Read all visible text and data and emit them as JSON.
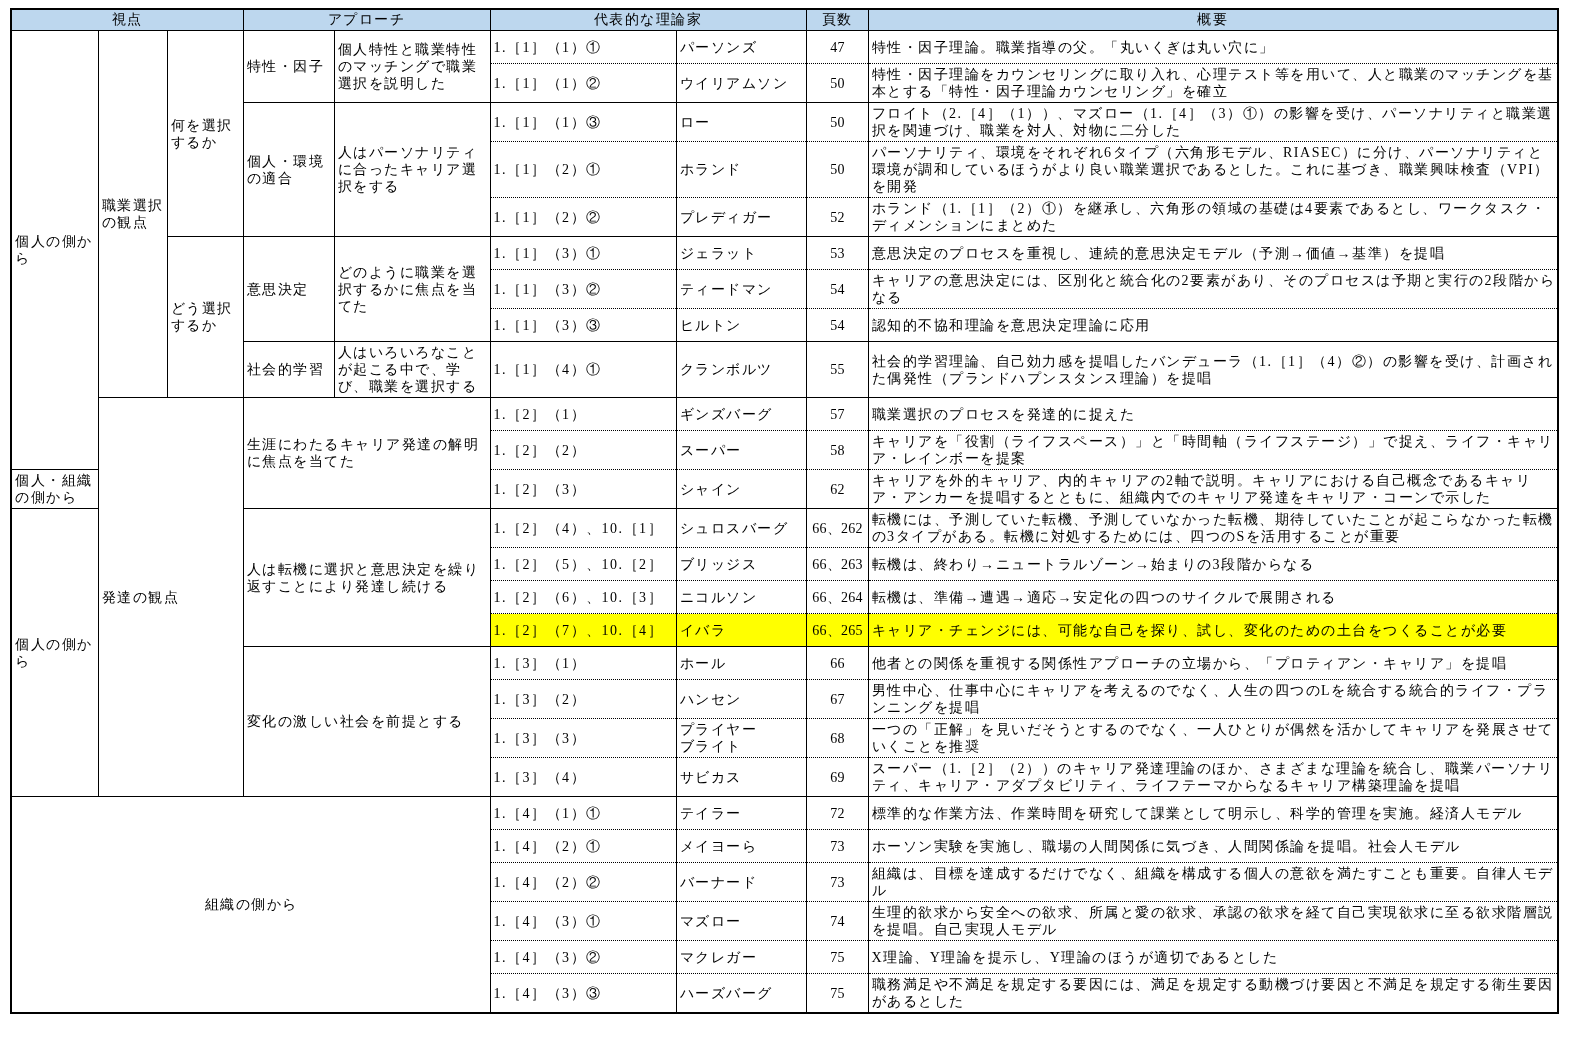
{
  "table": {
    "columns": [
      {
        "label": "視点"
      },
      {
        "label": "アプローチ"
      },
      {
        "label": "代表的な理論家"
      },
      {
        "label": "頁数"
      },
      {
        "label": "概要"
      }
    ],
    "rows": [
      {
        "side": "個人の側から",
        "viewpoint": {
          "text": "職業選択の観点",
          "kind": "single"
        },
        "focus": "何を選択するか",
        "approach": {
          "kind": "split",
          "name": "特性・因子",
          "description": "個人特性と職業特性のマッチングで職業選択を説明した"
        },
        "reference": "1.［1］（1）①",
        "theorists": [
          "パーソンズ"
        ],
        "pages": "47",
        "summary": "特性・因子理論。職業指導の父。「丸いくぎは丸い穴に」",
        "highlighted": false
      },
      {
        "reference": "1.［1］（1）②",
        "theorists": [
          "ウイリアムソン"
        ],
        "pages": "50",
        "summary": "特性・因子理論をカウンセリングに取り入れ、心理テスト等を用いて、人と職業のマッチングを基本とする「特性・因子理論カウンセリング」を確立",
        "highlighted": false
      },
      {
        "approach": {
          "kind": "split",
          "name": "個人・環境の適合",
          "description": "人はパーソナリティに合ったキャリア選択をする"
        },
        "reference": "1.［1］（1）③",
        "theorists": [
          "ロー"
        ],
        "pages": "50",
        "summary": "フロイト（2.［4］（1））、マズロー（1.［4］（3）①）の影響を受け、パーソナリティと職業選択を関連づけ、職業を対人、対物に二分した",
        "highlighted": false
      },
      {
        "reference": "1.［1］（2）①",
        "theorists": [
          "ホランド"
        ],
        "pages": "50",
        "summary": "パーソナリティ、環境をそれぞれ6タイプ（六角形モデル、RIASEC）に分け、パーソナリティと環境が調和しているほうがより良い職業選択であるとした。これに基づき、職業興味検査（VPI）を開発",
        "highlighted": false
      },
      {
        "reference": "1.［1］（2）②",
        "theorists": [
          "プレディガー"
        ],
        "pages": "52",
        "summary": "ホランド（1.［1］（2）①）を継承し、六角形の領域の基礎は4要素であるとし、ワークタスク・ディメンションにまとめた",
        "highlighted": false
      },
      {
        "focus": "どう選択するか",
        "approach": {
          "kind": "split",
          "name": "意思決定",
          "description": "どのように職業を選択するかに焦点を当てた"
        },
        "reference": "1.［1］（3）①",
        "theorists": [
          "ジェラット"
        ],
        "pages": "53",
        "summary": "意思決定のプロセスを重視し、連続的意思決定モデル（予測→価値→基準）を提唱",
        "highlighted": false
      },
      {
        "reference": "1.［1］（3）②",
        "theorists": [
          "ティードマン"
        ],
        "pages": "54",
        "summary": "キャリアの意思決定には、区別化と統合化の2要素があり、そのプロセスは予期と実行の2段階からなる",
        "highlighted": false
      },
      {
        "reference": "1.［1］（3）③",
        "theorists": [
          "ヒルトン"
        ],
        "pages": "54",
        "summary": "認知的不協和理論を意思決定理論に応用",
        "highlighted": false
      },
      {
        "approach": {
          "kind": "split",
          "name": "社会的学習",
          "description": "人はいろいろなことが起こる中で、学び、職業を選択する"
        },
        "reference": "1.［1］（4）①",
        "theorists": [
          "クランボルツ"
        ],
        "pages": "55",
        "summary": "社会的学習理論、自己効力感を提唱したバンデューラ（1.［1］（4）②）の影響を受け、計画された偶発性（プランドハプンスタンス理論）を提唱",
        "highlighted": false
      },
      {
        "viewpoint": {
          "text": "発達の観点",
          "kind": "wide"
        },
        "approach": {
          "kind": "merged",
          "description": "生涯にわたるキャリア発達の解明に焦点を当てた"
        },
        "reference": "1.［2］（1）",
        "theorists": [
          "ギンズバーグ"
        ],
        "pages": "57",
        "summary": "職業選択のプロセスを発達的に捉えた",
        "highlighted": false
      },
      {
        "reference": "1.［2］（2）",
        "theorists": [
          "スーパー"
        ],
        "pages": "58",
        "summary": "キャリアを「役割（ライフスペース）」と「時間軸（ライフステージ）」で捉え、ライフ・キャリア・レインボーを提案",
        "highlighted": false
      },
      {
        "side": "個人・組織の側から",
        "reference": "1.［2］（3）",
        "theorists": [
          "シャイン"
        ],
        "pages": "62",
        "summary": "キャリアを外的キャリア、内的キャリアの2軸で説明。キャリアにおける自己概念であるキャリア・アンカーを提唱するとともに、組織内でのキャリア発達をキャリア・コーンで示した",
        "highlighted": false
      },
      {
        "side": "個人の側から",
        "approach": {
          "kind": "merged",
          "description": "人は転機に選択と意思決定を繰り返すことにより発達し続ける"
        },
        "reference": "1.［2］（4）、10.［1］",
        "theorists": [
          "シュロスバーグ"
        ],
        "pages": "66、262",
        "summary": "転機には、予測していた転機、予測していなかった転機、期待していたことが起こらなかった転機の3タイプがある。転機に対処するためには、四つのSを活用することが重要",
        "highlighted": false
      },
      {
        "reference": "1.［2］（5）、10.［2］",
        "theorists": [
          "ブリッジス"
        ],
        "pages": "66、263",
        "summary": "転機は、終わり→ニュートラルゾーン→始まりの3段階からなる",
        "highlighted": false
      },
      {
        "reference": "1.［2］（6）、10.［3］",
        "theorists": [
          "ニコルソン"
        ],
        "pages": "66、264",
        "summary": "転機は、準備→遭遇→適応→安定化の四つのサイクルで展開される",
        "highlighted": false
      },
      {
        "reference": "1.［2］（7）、10.［4］",
        "theorists": [
          "イバラ"
        ],
        "pages": "66、265",
        "summary": "キャリア・チェンジには、可能な自己を探り、試し、変化のための土台をつくることが必要",
        "highlighted": true
      },
      {
        "approach": {
          "kind": "merged",
          "description": "変化の激しい社会を前提とする"
        },
        "reference": "1.［3］（1）",
        "theorists": [
          "ホール"
        ],
        "pages": "66",
        "summary": "他者との関係を重視する関係性アプローチの立場から、「プロティアン・キャリア」を提唱",
        "highlighted": false
      },
      {
        "reference": "1.［3］（2）",
        "theorists": [
          "ハンセン"
        ],
        "pages": "67",
        "summary": "男性中心、仕事中心にキャリアを考えるのでなく、人生の四つのLを統合する統合的ライフ・プランニングを提唱",
        "highlighted": false
      },
      {
        "reference": "1.［3］（3）",
        "theorists": [
          "プライヤー",
          "ブライト"
        ],
        "pages": "68",
        "summary": "一つの「正解」を見いだそうとするのでなく、一人ひとりが偶然を活かしてキャリアを発展させていくことを推奨",
        "highlighted": false
      },
      {
        "reference": "1.［3］（4）",
        "theorists": [
          "サビカス"
        ],
        "pages": "69",
        "summary": "スーパー（1.［2］（2））のキャリア発達理論のほか、さまざまな理論を統合し、職業パーソナリティ、キャリア・アダプタビリティ、ライフテーマからなるキャリア構築理論を提唱",
        "highlighted": false
      },
      {
        "merged_heading": "組織の側から",
        "reference": "1.［4］（1）①",
        "theorists": [
          "テイラー"
        ],
        "pages": "72",
        "summary": "標準的な作業方法、作業時間を研究して課業として明示し、科学的管理を実施。経済人モデル",
        "highlighted": false
      },
      {
        "reference": "1.［4］（2）①",
        "theorists": [
          "メイヨーら"
        ],
        "pages": "73",
        "summary": "ホーソン実験を実施し、職場の人間関係に気づき、人間関係論を提唱。社会人モデル",
        "highlighted": false
      },
      {
        "reference": "1.［4］（2）②",
        "theorists": [
          "バーナード"
        ],
        "pages": "73",
        "summary": "組織は、目標を達成するだけでなく、組織を構成する個人の意欲を満たすことも重要。自律人モデル",
        "highlighted": false
      },
      {
        "reference": "1.［4］（3）①",
        "theorists": [
          "マズロー"
        ],
        "pages": "74",
        "summary": "生理的欲求から安全への欲求、所属と愛の欲求、承認の欲求を経て自己実現欲求に至る欲求階層説を提唱。自己実現人モデル",
        "highlighted": false
      },
      {
        "reference": "1.［4］（3）②",
        "theorists": [
          "マクレガー"
        ],
        "pages": "75",
        "summary": "X理論、Y理論を提示し、Y理論のほうが適切であるとした",
        "highlighted": false
      },
      {
        "reference": "1.［4］（3）③",
        "theorists": [
          "ハーズバーグ"
        ],
        "pages": "75",
        "summary": "職務満足や不満足を規定する要因には、満足を規定する動機づけ要因と不満足を規定する衛生要因があるとした",
        "highlighted": false
      }
    ]
  }
}
